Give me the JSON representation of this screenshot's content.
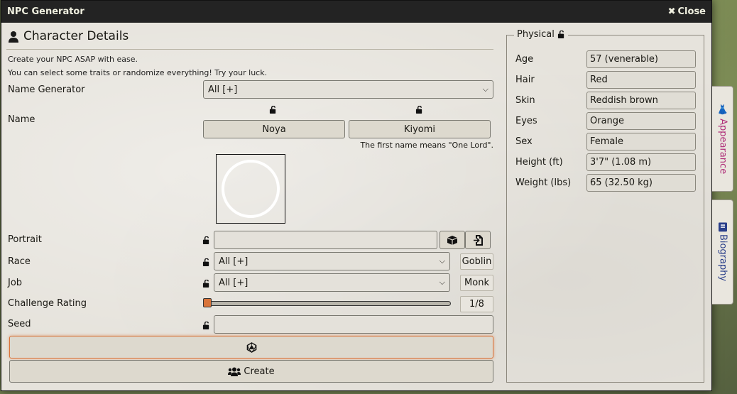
{
  "window": {
    "title": "NPC Generator",
    "close_label": "Close"
  },
  "details": {
    "heading": "Character Details",
    "hint_1": "Create your NPC ASAP with ease.",
    "hint_2": "You can select some traits or randomize everything! Try your luck.",
    "name_generator_label": "Name Generator",
    "name_generator_value": "All [+]",
    "name_label": "Name",
    "first_name": "Noya",
    "last_name": "Kiyomi",
    "name_meaning": "The first name means \"One Lord\".",
    "portrait_label": "Portrait",
    "portrait_value": "",
    "race_label": "Race",
    "race_value": "All [+]",
    "race_result": "Goblin",
    "job_label": "Job",
    "job_value": "All [+]",
    "job_result": "Monk",
    "cr_label": "Challenge Rating",
    "cr_value": "1/8",
    "cr_slider_fraction": 0.0,
    "seed_label": "Seed",
    "seed_value": "",
    "create_label": "Create"
  },
  "physical": {
    "legend": "Physical",
    "rows": [
      {
        "label": "Age",
        "value": "57 (venerable)"
      },
      {
        "label": "Hair",
        "value": "Red"
      },
      {
        "label": "Skin",
        "value": "Reddish brown"
      },
      {
        "label": "Eyes",
        "value": "Orange"
      },
      {
        "label": "Sex",
        "value": "Female"
      },
      {
        "label": "Height (ft)",
        "value": "3'7\" (1.08 m)"
      },
      {
        "label": "Weight (lbs)",
        "value": "65 (32.50 kg)"
      }
    ]
  },
  "tabs": {
    "appearance": "Appearance",
    "biography": "Biography"
  },
  "colors": {
    "accent_orange": "#d9743a",
    "tab_appearance": "#b0307a",
    "tab_biography": "#2a3f8a"
  },
  "icons": [
    "user-icon",
    "close-x-icon",
    "lock-icon",
    "unlock-icon",
    "dice-icon",
    "users-icon",
    "token-icon",
    "file-import-icon",
    "chevron-down-icon",
    "book-icon"
  ]
}
